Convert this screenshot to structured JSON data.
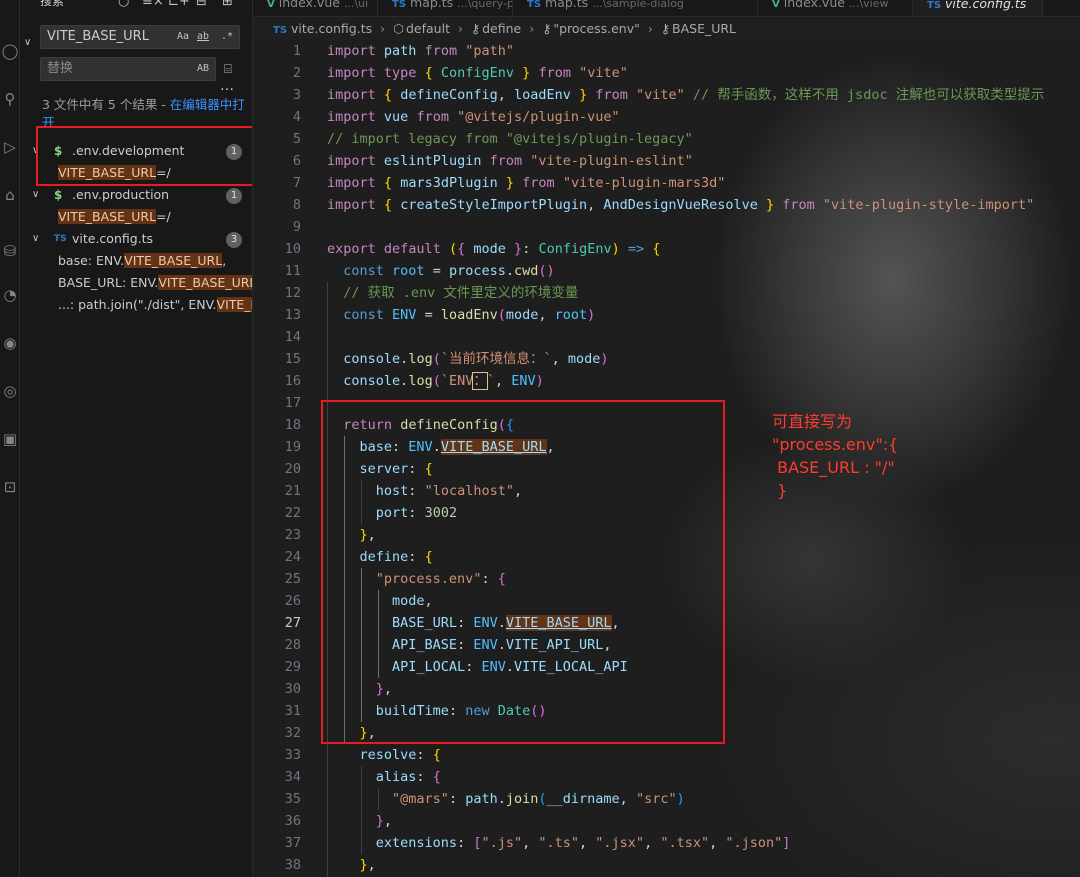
{
  "sidebar": {
    "title": "搜索",
    "search_value": "VITE_BASE_URL",
    "search_options": [
      "Aa",
      "ab",
      ".*"
    ],
    "replace_placeholder": "替换",
    "replace_option": "AB",
    "summary_text": "3 文件中有 5 个结果 - ",
    "summary_link": "在编辑器中打开",
    "results": [
      {
        "file": ".env.development",
        "icon": "$",
        "icon_color": "#89d185",
        "count": "1",
        "matches": [
          {
            "pre": "",
            "hit": "VITE_BASE_URL",
            "post": "=/"
          }
        ]
      },
      {
        "file": ".env.production",
        "icon": "$",
        "icon_color": "#89d185",
        "count": "1",
        "matches": [
          {
            "pre": "",
            "hit": "VITE_BASE_URL",
            "post": "=/"
          }
        ]
      },
      {
        "file": "vite.config.ts",
        "icon": "TS",
        "icon_color": "#3178c6",
        "count": "3",
        "matches": [
          {
            "pre": "base: ENV.",
            "hit": "VITE_BASE_URL",
            "post": ","
          },
          {
            "pre": "BASE_URL: ENV.",
            "hit": "VITE_BASE_URL",
            "post": ","
          },
          {
            "pre": "...: path.join(\"./dist\", ENV.",
            "hit": "VITE_B...",
            "post": ""
          }
        ]
      }
    ]
  },
  "tabs": [
    {
      "icon": "V",
      "label": "index.vue",
      "path": "...\\ui"
    },
    {
      "icon": "TS",
      "label": "map.ts",
      "path": "...\\query-poi"
    },
    {
      "icon": "TS",
      "label": "map.ts",
      "path": "...\\sample-dialog"
    },
    {
      "icon": "V",
      "label": "index.vue",
      "path": "...\\view"
    },
    {
      "icon": "TS",
      "label": "vite.config.ts",
      "path": "",
      "active": true
    }
  ],
  "breadcrumb": [
    "vite.config.ts",
    "default",
    "define",
    "\"process.env\"",
    "BASE_URL"
  ],
  "editor": {
    "active_line": 27,
    "lines": [
      {
        "n": 1,
        "html": "<span class=\"kc\">import</span> <span class=\"v\">path</span> <span class=\"kc\">from</span> <span class=\"s\">\"path\"</span>"
      },
      {
        "n": 2,
        "html": "<span class=\"kc\">import</span> <span class=\"kc\">type</span> <span class=\"b1\">{</span> <span class=\"t\">ConfigEnv</span> <span class=\"b1\">}</span> <span class=\"kc\">from</span> <span class=\"s\">\"vite\"</span>"
      },
      {
        "n": 3,
        "html": "<span class=\"kc\">import</span> <span class=\"b1\">{</span> <span class=\"v\">defineConfig</span>, <span class=\"v\">loadEnv</span> <span class=\"b1\">}</span> <span class=\"kc\">from</span> <span class=\"s\">\"vite\"</span> <span class=\"c\">// 帮手函数，这样不用 jsdoc 注解也可以获取类型提示</span>"
      },
      {
        "n": 4,
        "html": "<span class=\"kc\">import</span> <span class=\"v\">vue</span> <span class=\"kc\">from</span> <span class=\"s\">\"@vitejs/plugin-vue\"</span>"
      },
      {
        "n": 5,
        "html": "<span class=\"c\">// import legacy from \"@vitejs/plugin-legacy\"</span>"
      },
      {
        "n": 6,
        "html": "<span class=\"kc\">import</span> <span class=\"v\">eslintPlugin</span> <span class=\"kc\">from</span> <span class=\"s\">\"vite-plugin-eslint\"</span>"
      },
      {
        "n": 7,
        "html": "<span class=\"kc\">import</span> <span class=\"b1\">{</span> <span class=\"v\">mars3dPlugin</span> <span class=\"b1\">}</span> <span class=\"kc\">from</span> <span class=\"s\">\"vite-plugin-mars3d\"</span>"
      },
      {
        "n": 8,
        "html": "<span class=\"kc\">import</span> <span class=\"b1\">{</span> <span class=\"v\">createStyleImportPlugin</span>, <span class=\"v\">AndDesignVueResolve</span> <span class=\"b1\">}</span> <span class=\"kc\">from</span> <span class=\"s\">\"vite-plugin-style-import\"</span>"
      },
      {
        "n": 9,
        "html": ""
      },
      {
        "n": 10,
        "html": "<span class=\"kc\">export</span> <span class=\"kc\">default</span> <span class=\"b1\">(</span><span class=\"b2\">{</span> <span class=\"v\">mode</span> <span class=\"b2\">}</span>: <span class=\"t\">ConfigEnv</span><span class=\"b1\">)</span> <span class=\"k\">=&gt;</span> <span class=\"b1\">{</span>"
      },
      {
        "n": 11,
        "html": "  <span class=\"k\">const</span> <span class=\"cv\">root</span> = <span class=\"v\">process</span>.<span class=\"f\">cwd</span><span class=\"b2\">()</span>"
      },
      {
        "n": 12,
        "html": "  <span class=\"c\">// 获取 .env 文件里定义的环境变量</span>"
      },
      {
        "n": 13,
        "html": "  <span class=\"k\">const</span> <span class=\"cv\">ENV</span> = <span class=\"f\">loadEnv</span><span class=\"b2\">(</span><span class=\"v\">mode</span>, <span class=\"cv\">root</span><span class=\"b2\">)</span>"
      },
      {
        "n": 14,
        "html": ""
      },
      {
        "n": 15,
        "html": "  <span class=\"v\">console</span>.<span class=\"f\">log</span><span class=\"b2\">(</span><span class=\"s\">`当前环境信息：`</span>, <span class=\"v\">mode</span><span class=\"b2\">)</span>"
      },
      {
        "n": 16,
        "html": "  <span class=\"v\">console</span>.<span class=\"f\">log</span><span class=\"b2\">(</span><span class=\"s\">`ENV<span class=\"cursor-box\">：</span>`</span>, <span class=\"cv\">ENV</span><span class=\"b2\">)</span>"
      },
      {
        "n": 17,
        "html": ""
      },
      {
        "n": 18,
        "html": "  <span class=\"kc\">return</span> <span class=\"f\">defineConfig</span><span class=\"b2\">(</span><span class=\"b3\">{</span>"
      },
      {
        "n": 19,
        "html": "    <span class=\"v\">base</span>: <span class=\"cv\">ENV</span>.<span class=\"v mhl\">VITE_BASE_URL</span>,"
      },
      {
        "n": 20,
        "html": "    <span class=\"v\">server</span>: <span class=\"b1\">{</span>"
      },
      {
        "n": 21,
        "html": "      <span class=\"v\">host</span>: <span class=\"s\">\"localhost\"</span>,"
      },
      {
        "n": 22,
        "html": "      <span class=\"v\">port</span>: <span class=\"n\">3002</span>"
      },
      {
        "n": 23,
        "html": "    <span class=\"b1\">}</span>,"
      },
      {
        "n": 24,
        "html": "    <span class=\"v\">define</span>: <span class=\"b1\">{</span>"
      },
      {
        "n": 25,
        "html": "      <span class=\"s\">\"process.env\"</span>: <span class=\"b2\">{</span>"
      },
      {
        "n": 26,
        "html": "        <span class=\"v\">mode</span>,"
      },
      {
        "n": 27,
        "html": "        <span class=\"v\">BASE_URL</span>: <span class=\"cv\">ENV</span>.<span class=\"v mhl\">VITE_BASE_URL</span>,"
      },
      {
        "n": 28,
        "html": "        <span class=\"v\">API_BASE</span>: <span class=\"cv\">ENV</span>.<span class=\"v\">VITE_API_URL</span>,"
      },
      {
        "n": 29,
        "html": "        <span class=\"v\">API_LOCAL</span>: <span class=\"cv\">ENV</span>.<span class=\"v\">VITE_LOCAL_API</span>"
      },
      {
        "n": 30,
        "html": "      <span class=\"b2\">}</span>,"
      },
      {
        "n": 31,
        "html": "      <span class=\"v\">buildTime</span>: <span class=\"k\">new</span> <span class=\"t\">Date</span><span class=\"b2\">()</span>"
      },
      {
        "n": 32,
        "html": "    <span class=\"b1\">}</span>,"
      },
      {
        "n": 33,
        "html": "    <span class=\"v\">resolve</span>: <span class=\"b1\">{</span>"
      },
      {
        "n": 34,
        "html": "      <span class=\"v\">alias</span>: <span class=\"b2\">{</span>"
      },
      {
        "n": 35,
        "html": "        <span class=\"s\">\"@mars\"</span>: <span class=\"v\">path</span>.<span class=\"f\">join</span><span class=\"b3\">(</span><span class=\"v\">__dirname</span>, <span class=\"s\">\"src\"</span><span class=\"b3\">)</span>"
      },
      {
        "n": 36,
        "html": "      <span class=\"b2\">}</span>,"
      },
      {
        "n": 37,
        "html": "      <span class=\"v\">extensions</span>: <span class=\"b2\">[</span><span class=\"s\">\".js\"</span>, <span class=\"s\">\".ts\"</span>, <span class=\"s\">\".jsx\"</span>, <span class=\"s\">\".tsx\"</span>, <span class=\"s\">\".json\"</span><span class=\"b2\">]</span>"
      },
      {
        "n": 38,
        "html": "    <span class=\"b1\">}</span>,"
      }
    ]
  },
  "annotation": "可直接写为\n\"process.env\":{\n BASE_URL : \"/\"\n }",
  "colors": {
    "highlight": "#623315",
    "annotation_red": "#e51c23",
    "accent": "#0078d4"
  }
}
